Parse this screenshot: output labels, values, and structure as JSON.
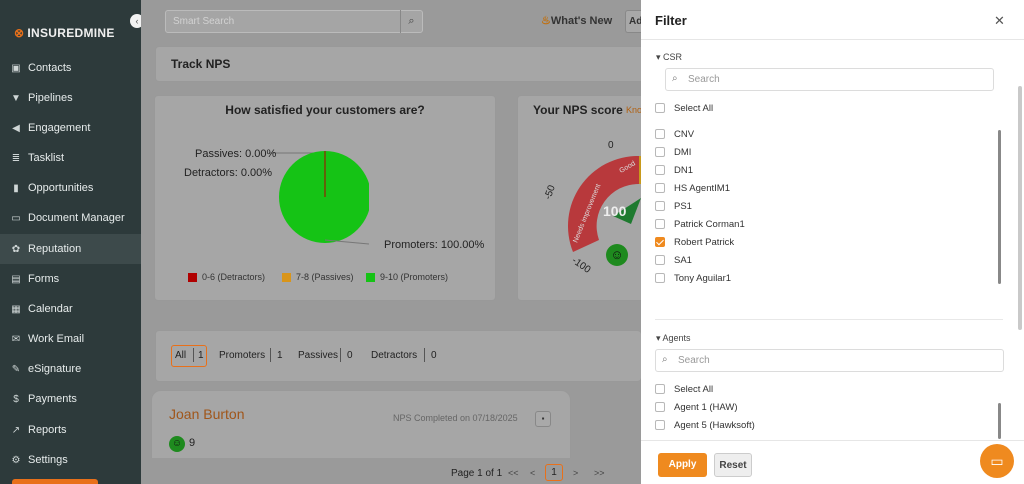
{
  "app": {
    "logo_text": "INSUREDMINE",
    "collapse_icon": "chevron-left-icon"
  },
  "sidebar": {
    "items": [
      {
        "label": "Contacts",
        "icon": "contacts-icon"
      },
      {
        "label": "Pipelines",
        "icon": "filter-icon"
      },
      {
        "label": "Engagement",
        "icon": "megaphone-icon"
      },
      {
        "label": "Tasklist",
        "icon": "list-icon"
      },
      {
        "label": "Opportunities",
        "icon": "bar-chart-icon"
      },
      {
        "label": "Document Manager",
        "icon": "folder-icon"
      },
      {
        "label": "Reputation",
        "icon": "reputation-icon",
        "active": true
      },
      {
        "label": "Forms",
        "icon": "form-icon"
      },
      {
        "label": "Calendar",
        "icon": "calendar-icon"
      },
      {
        "label": "Work Email",
        "icon": "mail-icon"
      },
      {
        "label": "eSignature",
        "icon": "signature-icon"
      },
      {
        "label": "Payments",
        "icon": "dollar-icon"
      },
      {
        "label": "Reports",
        "icon": "line-chart-icon"
      },
      {
        "label": "Settings",
        "icon": "gear-icon"
      }
    ]
  },
  "header": {
    "search_placeholder": "Smart Search",
    "whats_new": "What's New",
    "add_label": "Ad"
  },
  "main": {
    "track_title": "Track NPS",
    "satisfaction": {
      "title": "How satisfied your customers are?",
      "passives_label": "Passives: 0.00%",
      "detractors_label": "Detractors: 0.00%",
      "promoters_label": "Promoters: 100.00%",
      "legend": [
        {
          "label": "0-6 (Detractors)",
          "color": "#b00000"
        },
        {
          "label": "7-8 (Passives)",
          "color": "#d9951a"
        },
        {
          "label": "9-10 (Promoters)",
          "color": "#15c315"
        }
      ]
    },
    "nps": {
      "title": "Your NPS score",
      "know_link": "Kno",
      "score": "100",
      "min": "-100",
      "zero": "0",
      "neg50": "-50",
      "needs": "Needs improvement",
      "good": "Good"
    },
    "filters": [
      {
        "label": "All",
        "count": "1"
      },
      {
        "label": "Promoters",
        "count": "1"
      },
      {
        "label": "Passives",
        "count": "0"
      },
      {
        "label": "Detractors",
        "count": "0"
      }
    ],
    "person": {
      "name": "Joan Burton",
      "completed": "NPS Completed on 07/18/2025",
      "score": "9"
    },
    "pager": {
      "text": "Page 1 of 1",
      "first": "<<",
      "prev": "<",
      "current": "1",
      "next": ">",
      "last": ">>"
    }
  },
  "filter_panel": {
    "title": "Filter",
    "close_icon": "close-icon",
    "csr": {
      "label": "CSR",
      "search_placeholder": "Search",
      "options": [
        {
          "label": "Select All",
          "checked": false
        },
        {
          "label": "CNV",
          "checked": false
        },
        {
          "label": "DMI",
          "checked": false
        },
        {
          "label": "DN1",
          "checked": false
        },
        {
          "label": "HS AgentIM1",
          "checked": false
        },
        {
          "label": "PS1",
          "checked": false
        },
        {
          "label": "Patrick Corman1",
          "checked": false
        },
        {
          "label": "Robert Patrick",
          "checked": true
        },
        {
          "label": "SA1",
          "checked": false
        },
        {
          "label": "Tony Aguilar1",
          "checked": false
        }
      ]
    },
    "agents": {
      "label": "Agents",
      "search_placeholder": "Search",
      "options": [
        {
          "label": "Select All",
          "checked": false
        },
        {
          "label": "Agent 1 (HAW)",
          "checked": false
        },
        {
          "label": "Agent 5 (Hawksoft)",
          "checked": false
        }
      ]
    },
    "apply_label": "Apply",
    "reset_label": "Reset"
  }
}
